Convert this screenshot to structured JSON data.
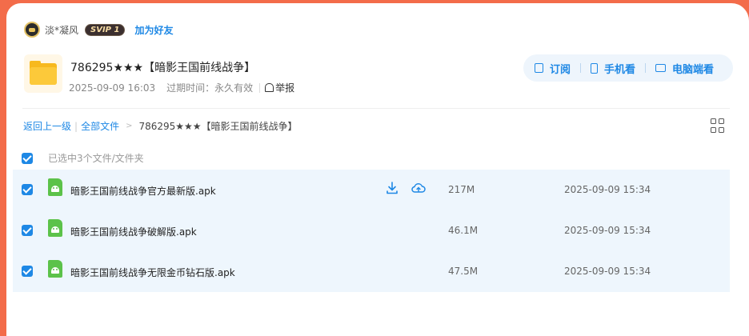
{
  "user": {
    "name": "淡*凝风",
    "vip_badge": "SVIP 1",
    "add_friend": "加为好友"
  },
  "share": {
    "title": "786295★★★【暗影王国前线战争】",
    "date": "2025-09-09 16:03",
    "expire_label": "过期时间：",
    "expire_value": "永久有效",
    "report": "举报"
  },
  "actions": {
    "subscribe": "订阅",
    "mobile": "手机看",
    "pc": "电脑端看"
  },
  "breadcrumb": {
    "back": "返回上一级",
    "all_files": "全部文件",
    "current": "786295★★★【暗影王国前线战争】"
  },
  "selection": {
    "text": "已选中3个文件/文件夹"
  },
  "files": [
    {
      "name": "暗影王国前线战争官方最新版.apk",
      "size": "217M",
      "date": "2025-09-09 15:34"
    },
    {
      "name": "暗影王国前线战争破解版.apk",
      "size": "46.1M",
      "date": "2025-09-09 15:34"
    },
    {
      "name": "暗影王国前线战争无限金币钻石版.apk",
      "size": "47.5M",
      "date": "2025-09-09 15:34"
    }
  ],
  "colors": {
    "accent": "#1e88e5",
    "page_bg": "#f36c4a",
    "row_bg": "#eef6fd",
    "folder": "#fcc93a",
    "apk": "#5cc24a"
  },
  "icons": [
    "avatar",
    "folder-icon",
    "report-icon",
    "subscribe-icon",
    "phone-icon",
    "monitor-icon",
    "grid-view-icon",
    "apk-icon",
    "download-icon",
    "cloud-save-icon"
  ]
}
